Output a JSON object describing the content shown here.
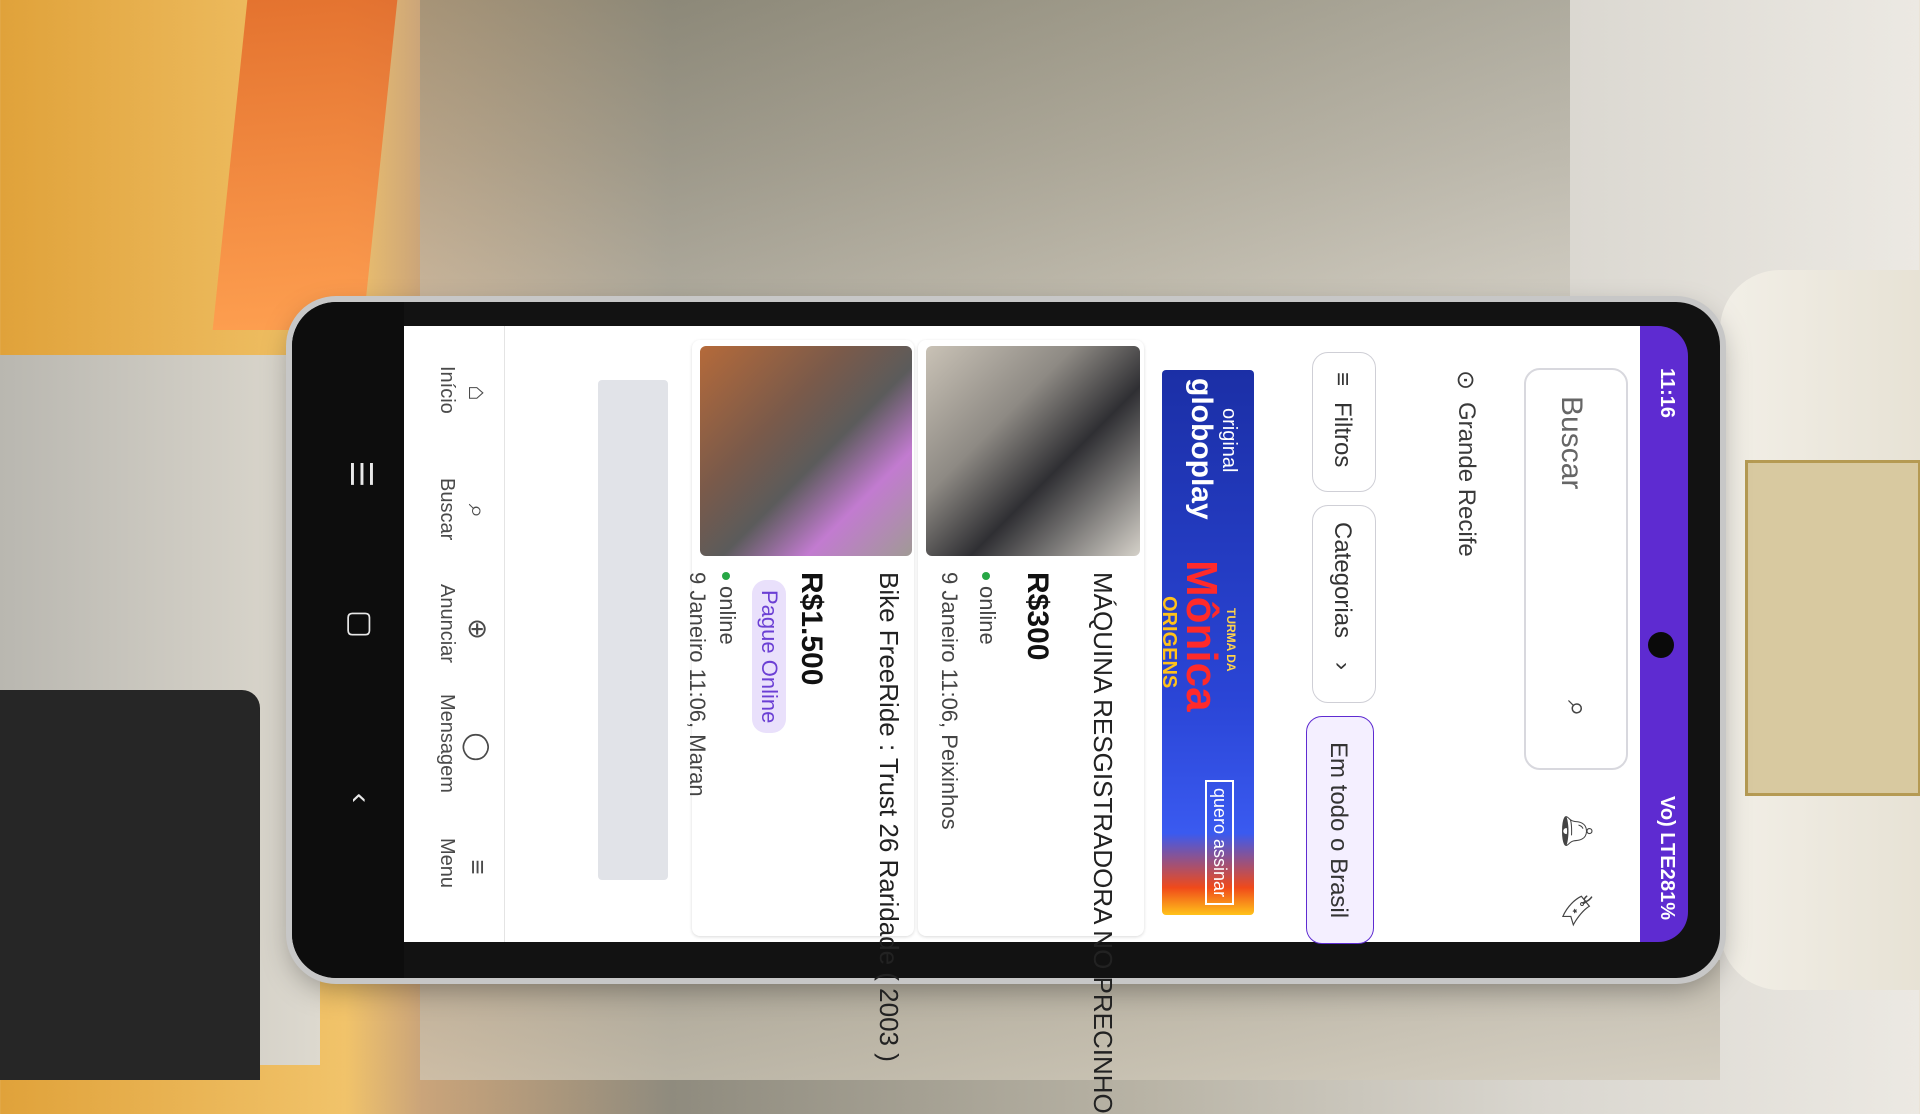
{
  "status_bar": {
    "time": "11:16",
    "battery": "81%",
    "network": "Vo) LTE2"
  },
  "header": {
    "search_placeholder": "Buscar",
    "icons": [
      "search-icon",
      "bell-icon",
      "bookmark-icon"
    ]
  },
  "location": {
    "label": "Grande Recife"
  },
  "filters": {
    "chips": [
      {
        "label": "Filtros"
      },
      {
        "label": "Categorias"
      },
      {
        "label": "Em todo o Brasil"
      }
    ]
  },
  "ad": {
    "line1": "original",
    "line2": "globoplay",
    "line3": "TURMA DA",
    "line4": "Mônica",
    "line5": "ORIGENS",
    "cta": "quero assinar"
  },
  "listings": [
    {
      "title": "MÁQUINA RESGISTRADORA NO PRECINHO",
      "price": "R$300",
      "status": "online",
      "date": "9 Janeiro 11:06, Peixinhos"
    },
    {
      "title": "Bike FreeRide : Trust 26 Raridade ( 2003 )",
      "badge": "Pague Online",
      "price": "R$1.500",
      "status": "online",
      "date": "9 Janeiro 11:06, Maran"
    }
  ],
  "bottom_nav": {
    "items": [
      {
        "label": "Início",
        "icon": "home-icon"
      },
      {
        "label": "Buscar",
        "icon": "search-icon"
      },
      {
        "label": "Anunciar",
        "icon": "plus-circle-icon"
      },
      {
        "label": "Mensagem",
        "icon": "chat-icon"
      },
      {
        "label": "Menu",
        "icon": "menu-icon"
      }
    ]
  },
  "colors": {
    "brand": "#5e2bd1",
    "online": "#27a745"
  }
}
